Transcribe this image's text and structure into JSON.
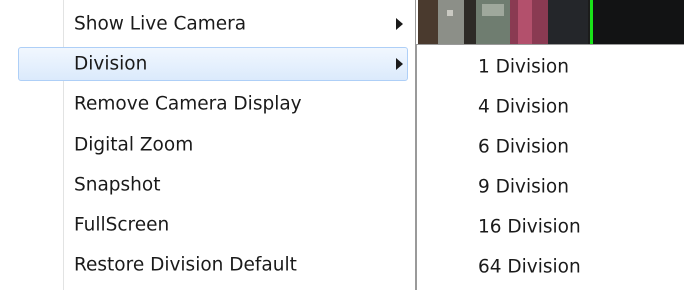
{
  "menu": {
    "items": [
      {
        "label": "Show Live Camera",
        "submenu": true
      },
      {
        "label": "Division",
        "submenu": true,
        "active": true
      },
      {
        "label": "Remove Camera Display",
        "submenu": false
      },
      {
        "label": "Digital Zoom",
        "submenu": false
      },
      {
        "label": "Snapshot",
        "submenu": false
      },
      {
        "label": "FullScreen",
        "submenu": false
      },
      {
        "label": "Restore Division Default",
        "submenu": false
      }
    ]
  },
  "division_submenu": {
    "items": [
      {
        "label": "1 Division"
      },
      {
        "label": "4 Division"
      },
      {
        "label": "6 Division"
      },
      {
        "label": "9 Division"
      },
      {
        "label": "16 Division"
      },
      {
        "label": "64 Division"
      }
    ]
  },
  "colors": {
    "highlight_border": "#aecff7",
    "highlight_fill": "#dbeafc",
    "text": "#1a1a1a",
    "camera_marker": "#19e319"
  },
  "icons": {
    "submenu_arrow": "chevron-right-icon"
  }
}
